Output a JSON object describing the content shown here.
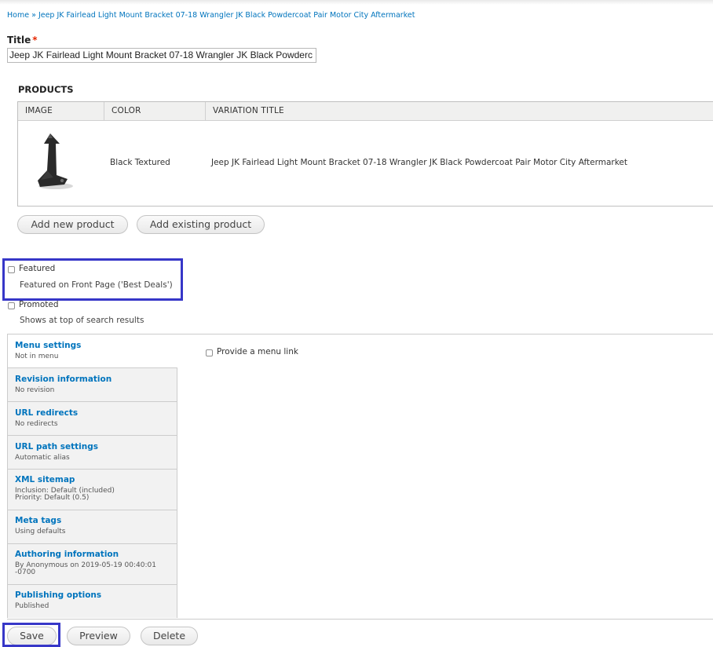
{
  "breadcrumb": {
    "home": "Home",
    "separator": "»",
    "current": "Jeep JK Fairlead Light Mount Bracket 07-18 Wrangler JK Black Powdercoat Pair Motor City Aftermarket"
  },
  "title_field": {
    "label": "Title",
    "required_marker": "*",
    "value": "Jeep JK Fairlead Light Mount Bracket 07-18 Wrangler JK Black Powderc"
  },
  "products": {
    "heading": "PRODUCTS",
    "columns": [
      "IMAGE",
      "COLOR",
      "VARIATION TITLE"
    ],
    "rows": [
      {
        "image_icon": "bracket-product-thumbnail",
        "color": "Black Textured",
        "variation_title": "Jeep JK Fairlead Light Mount Bracket 07-18 Wrangler JK Black Powdercoat Pair Motor City Aftermarket"
      }
    ],
    "add_new_label": "Add new product",
    "add_existing_label": "Add existing product"
  },
  "featured": {
    "label": "Featured",
    "description": "Featured on Front Page ('Best Deals')",
    "checked": false
  },
  "promoted": {
    "label": "Promoted",
    "description": "Shows at top of search results",
    "checked": false
  },
  "vertical_tabs": [
    {
      "title": "Menu settings",
      "summary": [
        "Not in menu"
      ]
    },
    {
      "title": "Revision information",
      "summary": [
        "No revision"
      ]
    },
    {
      "title": "URL redirects",
      "summary": [
        "No redirects"
      ]
    },
    {
      "title": "URL path settings",
      "summary": [
        "Automatic alias"
      ]
    },
    {
      "title": "XML sitemap",
      "summary": [
        "Inclusion: Default (included)",
        "Priority: Default (0.5)"
      ]
    },
    {
      "title": "Meta tags",
      "summary": [
        "Using defaults"
      ]
    },
    {
      "title": "Authoring information",
      "summary": [
        "By Anonymous on 2019-05-19 00:40:01",
        "-0700"
      ]
    },
    {
      "title": "Publishing options",
      "summary": [
        "Published"
      ]
    }
  ],
  "menu_panel": {
    "provide_menu_link_label": "Provide a menu link",
    "checked": false
  },
  "actions": {
    "save": "Save",
    "preview": "Preview",
    "delete": "Delete"
  },
  "colors": {
    "link": "#0074bd",
    "highlight_border": "#3737c8",
    "required": "#e62600"
  }
}
